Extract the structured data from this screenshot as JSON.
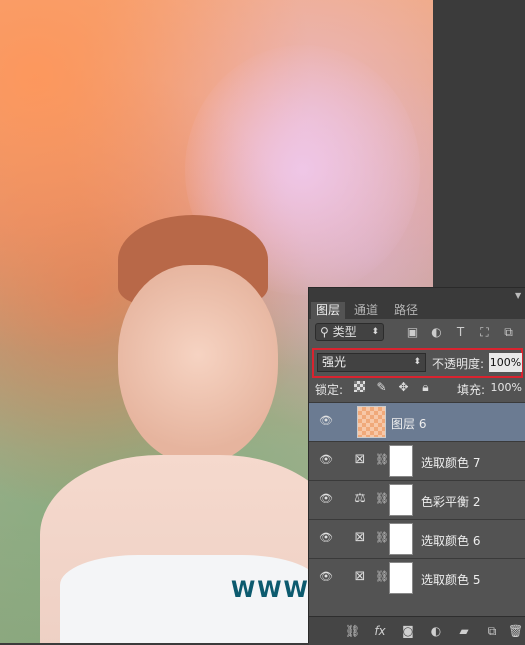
{
  "panel": {
    "tabs": [
      {
        "label": "图层"
      },
      {
        "label": "通道"
      },
      {
        "label": "路径"
      }
    ],
    "filter": {
      "label": "类型"
    },
    "blend_mode": "强光",
    "opacity_label": "不透明度:",
    "opacity_value": "100%",
    "lock_label": "锁定:",
    "fill_label": "填充:",
    "fill_value": "100%",
    "layers": [
      {
        "name": "图层 6",
        "type": "pixel",
        "selected": true
      },
      {
        "name": "选取颜色 7",
        "type": "selective-color"
      },
      {
        "name": "色彩平衡 2",
        "type": "color-balance"
      },
      {
        "name": "选取颜色 6",
        "type": "selective-color"
      },
      {
        "name": "选取颜色 5",
        "type": "selective-color"
      }
    ]
  },
  "watermark": "WWW. PSAHZ. COM",
  "colors": {
    "selected_row": "#6b7b92",
    "highlight_border": "#d9232f",
    "panel_bg": "#535353",
    "watermark": "#0c5a6e"
  }
}
